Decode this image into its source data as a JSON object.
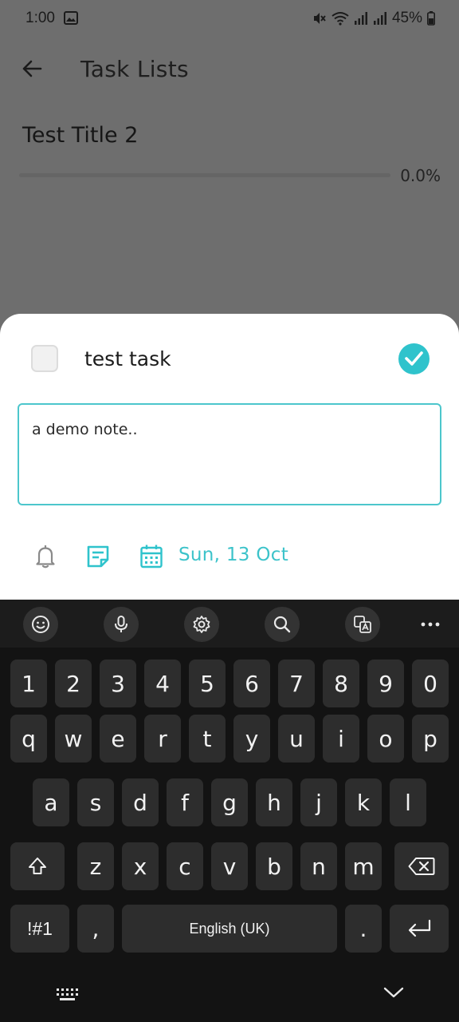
{
  "status_bar": {
    "time": "1:00",
    "battery": "45%"
  },
  "app_bar": {
    "title": "Task Lists"
  },
  "task_list": {
    "title": "Test Title 2",
    "progress_label": "0.0%",
    "progress_fraction": 0.0
  },
  "sheet": {
    "task_name": "test task",
    "task_checked": false,
    "note": "a demo note..",
    "date_label": "Sun, 13 Oct",
    "accent_color": "#2fc3cc"
  },
  "keyboard": {
    "toolbar": [
      "emoji-icon",
      "microphone-icon",
      "settings-icon",
      "search-icon",
      "translate-icon",
      "more-icon"
    ],
    "row_numbers": [
      "1",
      "2",
      "3",
      "4",
      "5",
      "6",
      "7",
      "8",
      "9",
      "0"
    ],
    "row_top": [
      "q",
      "w",
      "e",
      "r",
      "t",
      "y",
      "u",
      "i",
      "o",
      "p"
    ],
    "row_middle": [
      "a",
      "s",
      "d",
      "f",
      "g",
      "h",
      "j",
      "k",
      "l"
    ],
    "row_bottom": [
      "z",
      "x",
      "c",
      "v",
      "b",
      "n",
      "m"
    ],
    "symbols_label": "!#1",
    "comma_label": ",",
    "space_label": "English (UK)",
    "period_label": "."
  }
}
